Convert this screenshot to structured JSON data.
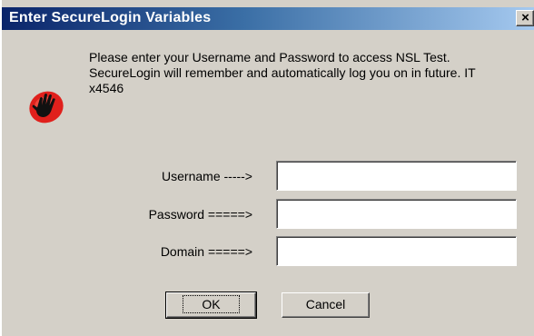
{
  "window": {
    "title": "Enter SecureLogin Variables",
    "close_glyph": "×"
  },
  "message": {
    "line1": "Please enter your Username and Password to access NSL Test.",
    "line2": "SecureLogin will remember and automatically log you on in future.  IT",
    "line3": "x4546"
  },
  "fields": {
    "username": {
      "label": "Username ----->",
      "value": ""
    },
    "password": {
      "label": "Password =====>",
      "value": ""
    },
    "domain": {
      "label": "Domain =====>",
      "value": ""
    }
  },
  "buttons": {
    "ok": "OK",
    "cancel": "Cancel"
  },
  "icons": {
    "app": "stop-hand-icon",
    "close": "close-icon"
  },
  "colors": {
    "titlebar_start": "#0a246a",
    "titlebar_end": "#a6caf0",
    "dialog_bg": "#d4d0c8",
    "icon_red": "#e0201c"
  }
}
